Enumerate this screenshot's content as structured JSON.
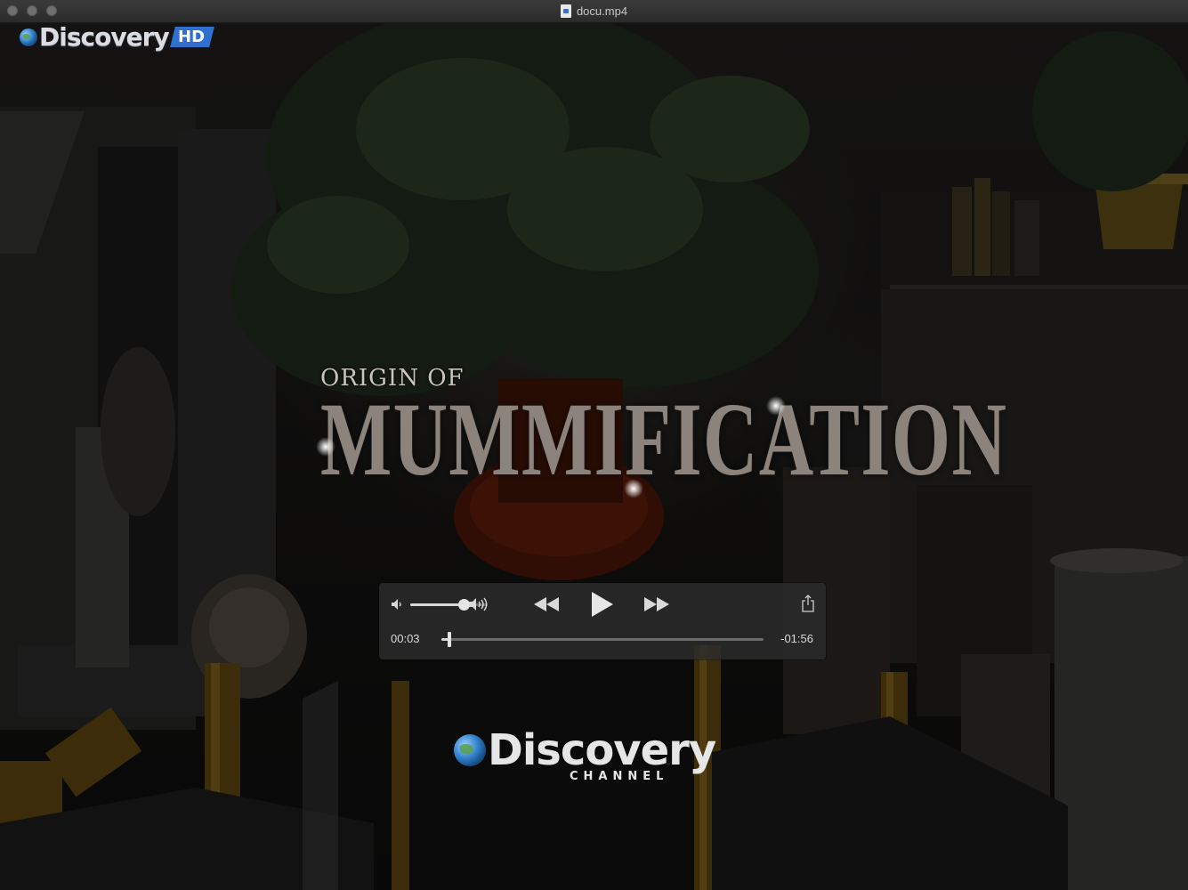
{
  "window": {
    "title": "docu.mp4"
  },
  "video": {
    "overlay_logo_top": {
      "wordmark": "Discovery",
      "badge": "HD"
    },
    "title_card": {
      "line1": "ORIGIN OF",
      "line2": "MUMMIFICATION"
    },
    "overlay_logo_bottom": {
      "wordmark": "Discovery",
      "subtitle": "CHANNEL"
    }
  },
  "controls": {
    "volume_level": 0.7,
    "elapsed": "00:03",
    "remaining": "-01:56",
    "progress_fraction": 0.025,
    "icons": {
      "volume_low": "speaker-low-icon",
      "volume_high": "speaker-high-icon",
      "rewind": "rewind-icon",
      "play": "play-icon",
      "fast_forward": "fast-forward-icon",
      "share": "share-icon"
    }
  },
  "colors": {
    "hud_background": "#2c2c2c",
    "hud_text": "#d9d9d9",
    "hd_badge": "#2f6fd0",
    "title_text": "#8b837c"
  }
}
